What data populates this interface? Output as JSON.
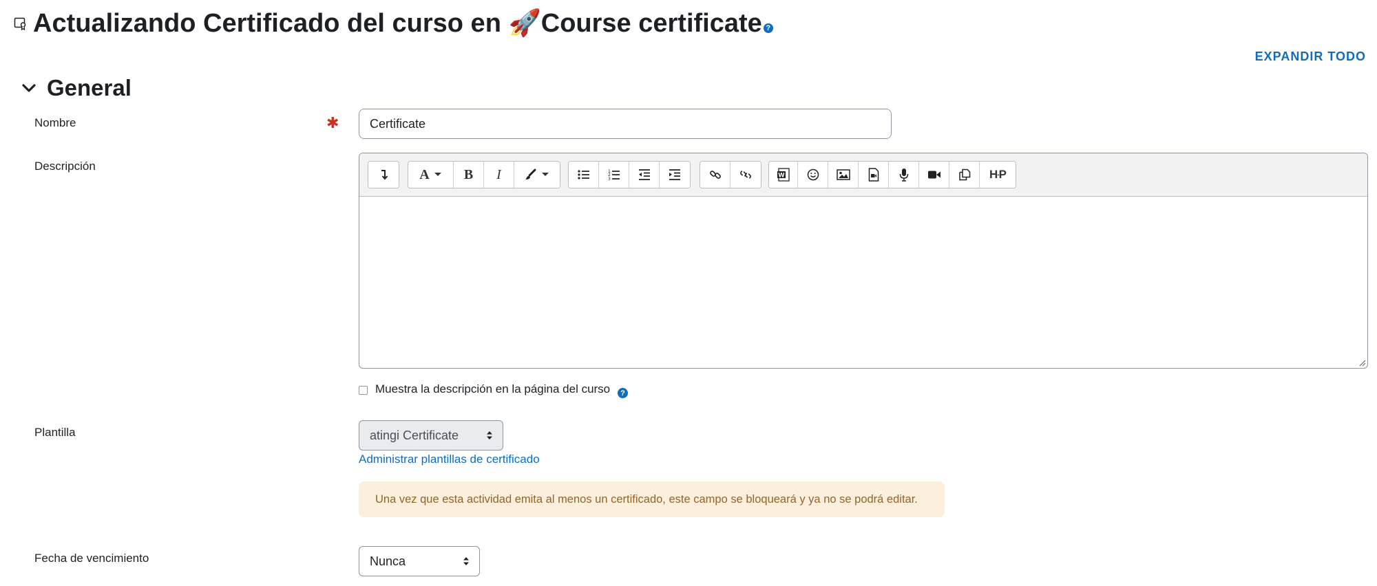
{
  "header": {
    "page_title": "Actualizando Certificado del curso en 🚀Course certificate",
    "expand_all_label": "EXPANDIR TODO"
  },
  "section": {
    "title": "General"
  },
  "form": {
    "name_label": "Nombre",
    "name_value": "Certificate",
    "description_label": "Descripción",
    "show_description_label": "Muestra la descripción en la página del curso",
    "show_description_checked": false,
    "template_label": "Plantilla",
    "template_value": "atingi Certificate",
    "manage_templates_link": "Administrar plantillas de certificado",
    "template_warning": "Una vez que esta actividad emita al menos un certificado, este campo se bloqueará y ya no se podrá editar.",
    "expiry_label": "Fecha de vencimiento",
    "expiry_value": "Nunca"
  },
  "colors": {
    "accent": "#0f6cbf",
    "required": "#ca3120",
    "warning_bg": "#fcefdc",
    "warning_text": "#8e662e",
    "text": "#1d2125"
  },
  "toolbar": {
    "icons": [
      "show-more-icon",
      "font-style-icon",
      "bold-icon",
      "italic-icon",
      "text-color-icon",
      "unordered-list-icon",
      "ordered-list-icon",
      "outdent-icon",
      "indent-icon",
      "link-icon",
      "unlink-icon",
      "word-import-icon",
      "emoticon-icon",
      "image-icon",
      "media-icon",
      "record-audio-icon",
      "record-video-icon",
      "manage-files-icon",
      "h5p-icon"
    ]
  }
}
